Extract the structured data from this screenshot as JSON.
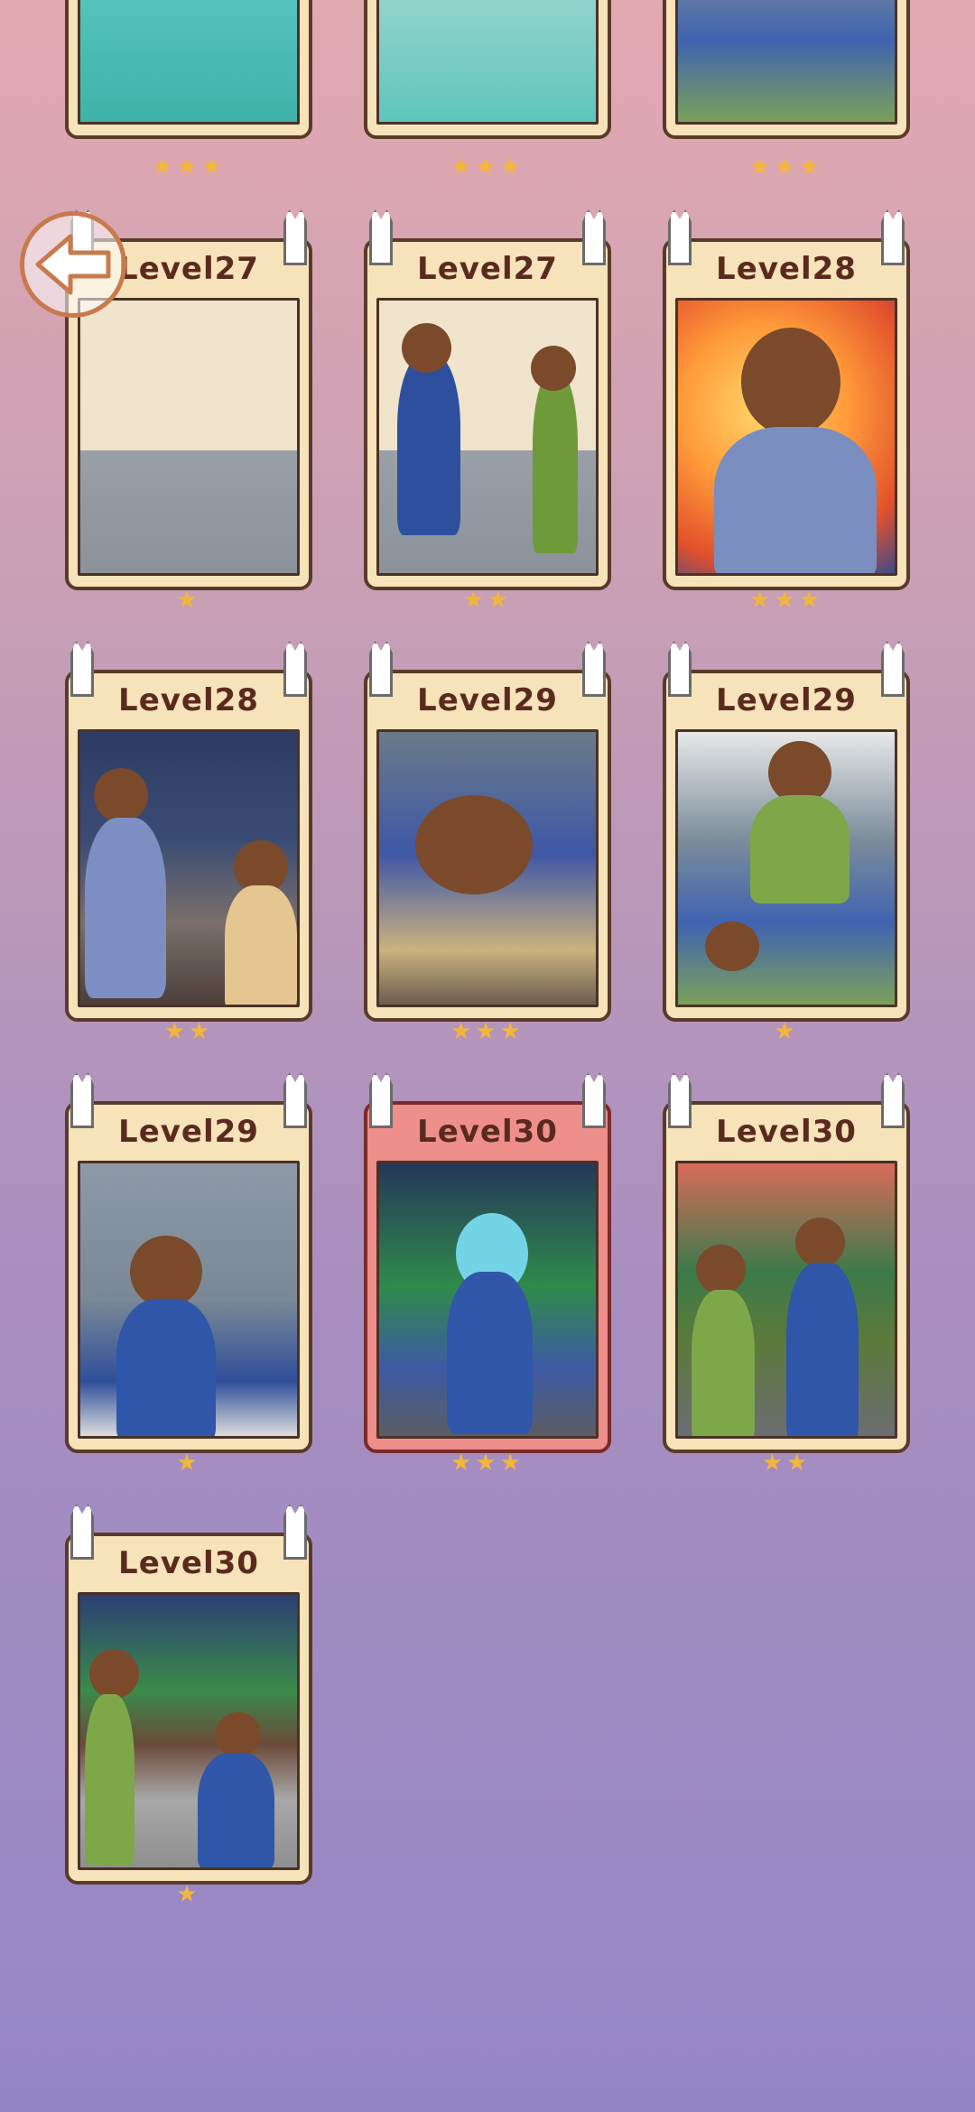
{
  "back_button": {
    "icon": "back-arrow-icon"
  },
  "top_row_stars": [
    3,
    3,
    3
  ],
  "cards": [
    {
      "label": "Level27",
      "stars": 1,
      "scene": "room"
    },
    {
      "label": "Level27",
      "stars": 2,
      "scene": "room"
    },
    {
      "label": "Level28",
      "stars": 3,
      "scene": "fire"
    },
    {
      "label": "Level28",
      "stars": 2,
      "scene": "night"
    },
    {
      "label": "Level29",
      "stars": 3,
      "scene": "sleep"
    },
    {
      "label": "Level29",
      "stars": 1,
      "scene": "fire2"
    },
    {
      "label": "Level29",
      "stars": 1,
      "scene": "wall"
    },
    {
      "label": "Level30",
      "stars": 3,
      "scene": "rainblue",
      "selected": true
    },
    {
      "label": "Level30",
      "stars": 2,
      "scene": "umbrella"
    },
    {
      "label": "Level30",
      "stars": 1,
      "scene": "garden"
    }
  ],
  "colors": {
    "star": "#f2b63c",
    "card_bg": "#f7e3ba",
    "card_selected_bg": "#ee8f8c",
    "label": "#5a2a1e"
  }
}
